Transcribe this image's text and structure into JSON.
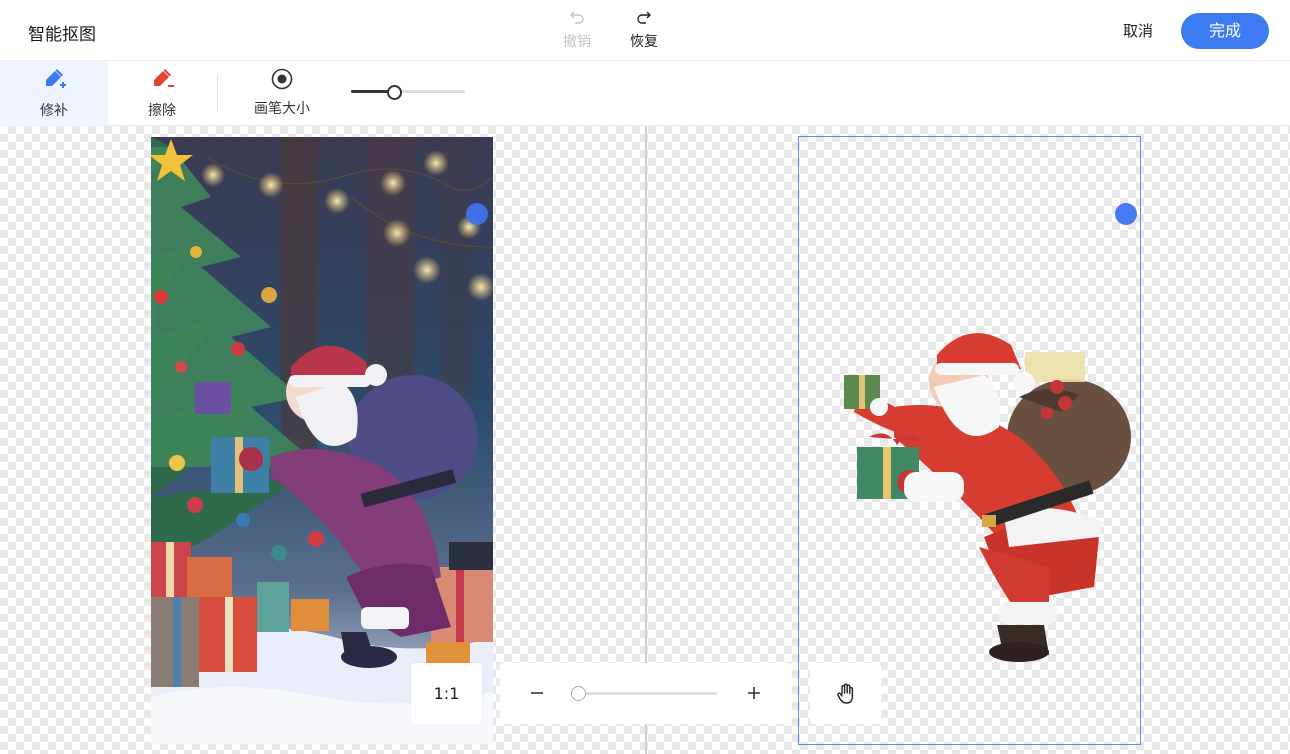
{
  "header": {
    "title": "智能抠图",
    "undo_label": "撤销",
    "redo_label": "恢复",
    "cancel_label": "取消",
    "done_label": "完成"
  },
  "toolbar": {
    "tools": [
      {
        "label": "修补",
        "icon": "brush-plus-icon",
        "active": true
      },
      {
        "label": "擦除",
        "icon": "brush-minus-icon",
        "active": false
      }
    ],
    "brush_size_label": "画笔大小",
    "brush_size_value": 0.38
  },
  "zoom": {
    "ratio_label": "1:1",
    "level": 0.0
  },
  "colors": {
    "accent": "#3d7bf0",
    "erase_red": "#e0433a",
    "selection_border": "#5b8fee"
  }
}
